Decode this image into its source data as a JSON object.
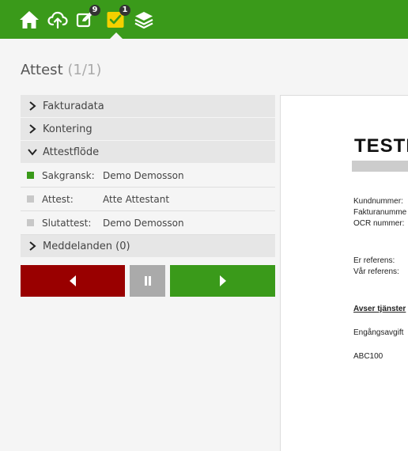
{
  "nav": {
    "home": {
      "icon": "home-icon"
    },
    "upload": {
      "icon": "cloud-upload-icon"
    },
    "edit": {
      "icon": "edit-icon",
      "badge": "9"
    },
    "attest": {
      "icon": "check-square-icon",
      "badge": "1"
    },
    "layers": {
      "icon": "layers-icon"
    },
    "colors": {
      "bar": "#3a9a1a",
      "attest_icon": "#f5d000"
    }
  },
  "page": {
    "title": "Attest",
    "count": "(1/1)"
  },
  "sections": {
    "fakturadata": "Fakturadata",
    "kontering": "Kontering",
    "attestflode": "Attestflöde",
    "meddelanden": "Meddelanden (0)"
  },
  "flow": [
    {
      "role": "Sakgransk:",
      "person": "Demo Demosson",
      "status_color": "#3a9a1a"
    },
    {
      "role": "Attest:",
      "person": "Atte Attestant",
      "status_color": "#c8c8c8"
    },
    {
      "role": "Slutattest:",
      "person": "Demo Demosson",
      "status_color": "#c8c8c8"
    }
  ],
  "buttons": {
    "back": {
      "icon": "triangle-left-icon",
      "color": "#990000"
    },
    "pause": {
      "icon": "pause-icon",
      "color": "#aaaaaa"
    },
    "forward": {
      "icon": "triangle-right-icon",
      "color": "#3a9a1a"
    }
  },
  "document": {
    "logo": "TESTI",
    "kundnummer": "Kundnummer:",
    "fakturanummer": "Fakturanumme",
    "ocr": "OCR nummer:",
    "er_referens": "Er referens:",
    "var_referens": "Vår referens:",
    "avser": "Avser tjänster",
    "engangsavgift": "Engångsavgift",
    "article": "ABC100"
  }
}
